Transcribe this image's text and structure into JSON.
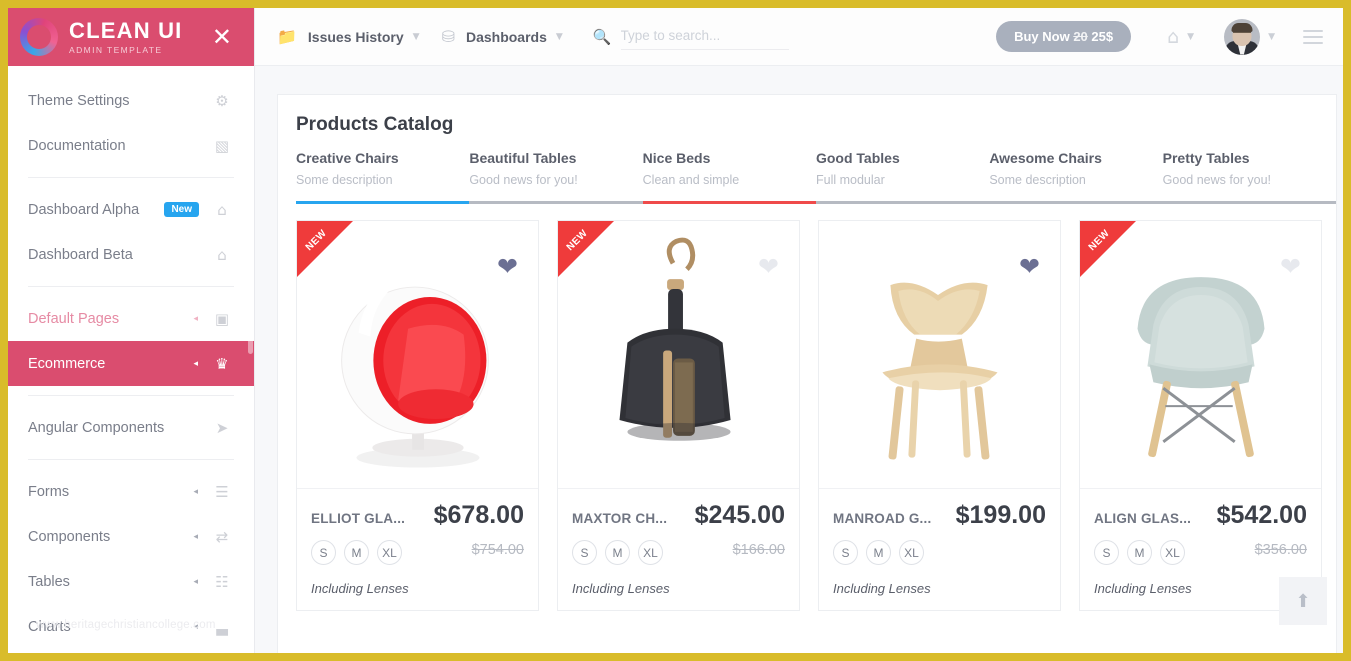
{
  "brand": {
    "title": "CLEAN UI",
    "subtitle": "ADMIN TEMPLATE",
    "close_icon": "close-icon"
  },
  "sidebar": {
    "watermark": "www.heritagechristiancollege.com",
    "items": [
      {
        "label": "Theme Settings",
        "icon": "⚙",
        "badge": "",
        "caret": "",
        "state": ""
      },
      {
        "label": "Documentation",
        "icon": "▧",
        "badge": "",
        "caret": "",
        "state": ""
      },
      {
        "separator": true
      },
      {
        "label": "Dashboard Alpha",
        "icon": "⌂",
        "badge": "New",
        "caret": "",
        "state": ""
      },
      {
        "label": "Dashboard Beta",
        "icon": "⌂",
        "badge": "",
        "caret": "",
        "state": ""
      },
      {
        "separator": true
      },
      {
        "label": "Default Pages",
        "icon": "▣",
        "badge": "",
        "caret": "◂",
        "state": "faded"
      },
      {
        "label": "Ecommerce",
        "icon": "♛",
        "badge": "",
        "caret": "◂",
        "state": "active"
      },
      {
        "separator": true
      },
      {
        "label": "Angular Components",
        "icon": "➤",
        "badge": "",
        "caret": "",
        "state": ""
      },
      {
        "separator": true
      },
      {
        "label": "Forms",
        "icon": "☰",
        "badge": "",
        "caret": "◂",
        "state": ""
      },
      {
        "label": "Components",
        "icon": "⇄",
        "badge": "",
        "caret": "◂",
        "state": ""
      },
      {
        "label": "Tables",
        "icon": "☷",
        "badge": "",
        "caret": "◂",
        "state": ""
      },
      {
        "label": "Charts",
        "icon": "▃",
        "badge": "",
        "caret": "◂",
        "state": ""
      }
    ]
  },
  "topbar": {
    "nav": [
      {
        "label": "Issues History",
        "icon": "📁",
        "caret": "▼"
      },
      {
        "label": "Dashboards",
        "icon": "⛁",
        "caret": "▼"
      }
    ],
    "search": {
      "placeholder": "Type to search...",
      "value": "",
      "icon": "🔍"
    },
    "buy_button": {
      "prefix": "Buy Now ",
      "old": "20",
      "new": " 25$"
    },
    "home_icon": "⌂",
    "caret": "▼",
    "avatar": "user-avatar",
    "menu_icon": "hamburger-icon"
  },
  "main": {
    "panel_title": "Products Catalog",
    "tabs": [
      {
        "label": "Creative Chairs",
        "desc": "Some description",
        "color": "#27a5ef"
      },
      {
        "label": "Beautiful Tables",
        "desc": "Good news for you!",
        "color": "#b6bac2"
      },
      {
        "label": "Nice Beds",
        "desc": "Clean and simple",
        "color": "#ef4a4a"
      },
      {
        "label": "Good Tables",
        "desc": "Full modular",
        "color": "#b6bac2"
      },
      {
        "label": "Awesome Chairs",
        "desc": "Some description",
        "color": "#b6bac2"
      },
      {
        "label": "Pretty Tables",
        "desc": "Good news for you!",
        "color": "#b6bac2"
      }
    ],
    "products": [
      {
        "name": "ELLIOT GLA...",
        "price": "$678.00",
        "old_price": "$754.00",
        "sizes": [
          "S",
          "M",
          "XL"
        ],
        "note": "Including Lenses",
        "ribbon": "NEW",
        "favorite": true,
        "image": "ball-chair-red-white"
      },
      {
        "name": "MAXTOR CH...",
        "price": "$245.00",
        "old_price": "$166.00",
        "sizes": [
          "S",
          "M",
          "XL"
        ],
        "note": "Including Lenses",
        "ribbon": "NEW",
        "favorite": false,
        "image": "dustpan-brush-black"
      },
      {
        "name": "MANROAD G...",
        "price": "$199.00",
        "old_price": "",
        "sizes": [
          "S",
          "M",
          "XL"
        ],
        "note": "Including Lenses",
        "ribbon": "",
        "favorite": true,
        "image": "wooden-chair-light"
      },
      {
        "name": "ALIGN GLAS...",
        "price": "$542.00",
        "old_price": "$356.00",
        "sizes": [
          "S",
          "M",
          "XL"
        ],
        "note": "Including Lenses",
        "ribbon": "NEW",
        "favorite": false,
        "image": "eames-chair-grey"
      }
    ],
    "scroll_top_icon": "⬆"
  },
  "colors": {
    "accent_pink": "#da4d6f",
    "border_yellow": "#d9bc2a",
    "badge_blue": "#27a5ef",
    "ribbon_red": "#ef3b3b",
    "heart_on": "#6b6f93"
  }
}
